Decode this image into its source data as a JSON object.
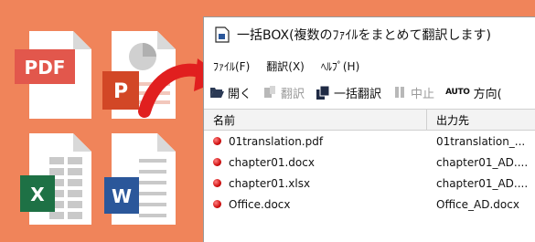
{
  "colors": {
    "background": "#f0845a",
    "arrow": "#e11f1f",
    "pdf": "#e2574c",
    "powerpoint": "#d24726",
    "excel": "#1e7145",
    "word": "#2b579a"
  },
  "file_icons": [
    {
      "name": "pdf-file-icon",
      "label": "PDF"
    },
    {
      "name": "powerpoint-file-icon",
      "label": "P"
    },
    {
      "name": "excel-file-icon",
      "label": "X"
    },
    {
      "name": "word-file-icon",
      "label": "W"
    }
  ],
  "window": {
    "title": "一括BOX(複数のﾌｧｲﾙをまとめて翻訳します)",
    "menu": [
      "ﾌｧｲﾙ(F)",
      "翻訳(X)",
      "ﾍﾙﾌﾟ(H)"
    ],
    "toolbar": {
      "open": "開く",
      "translate": "翻訳",
      "batch_translate": "一括翻訳",
      "stop": "中止",
      "auto": "AUTO",
      "direction": "方向("
    },
    "list": {
      "columns": [
        "名前",
        "出力先"
      ],
      "rows": [
        {
          "name": "01translation.pdf",
          "output": "01translation_..."
        },
        {
          "name": "chapter01.docx",
          "output": "chapter01_AD...."
        },
        {
          "name": "chapter01.xlsx",
          "output": "chapter01_AD...."
        },
        {
          "name": "Office.docx",
          "output": "Office_AD.docx"
        }
      ]
    }
  }
}
